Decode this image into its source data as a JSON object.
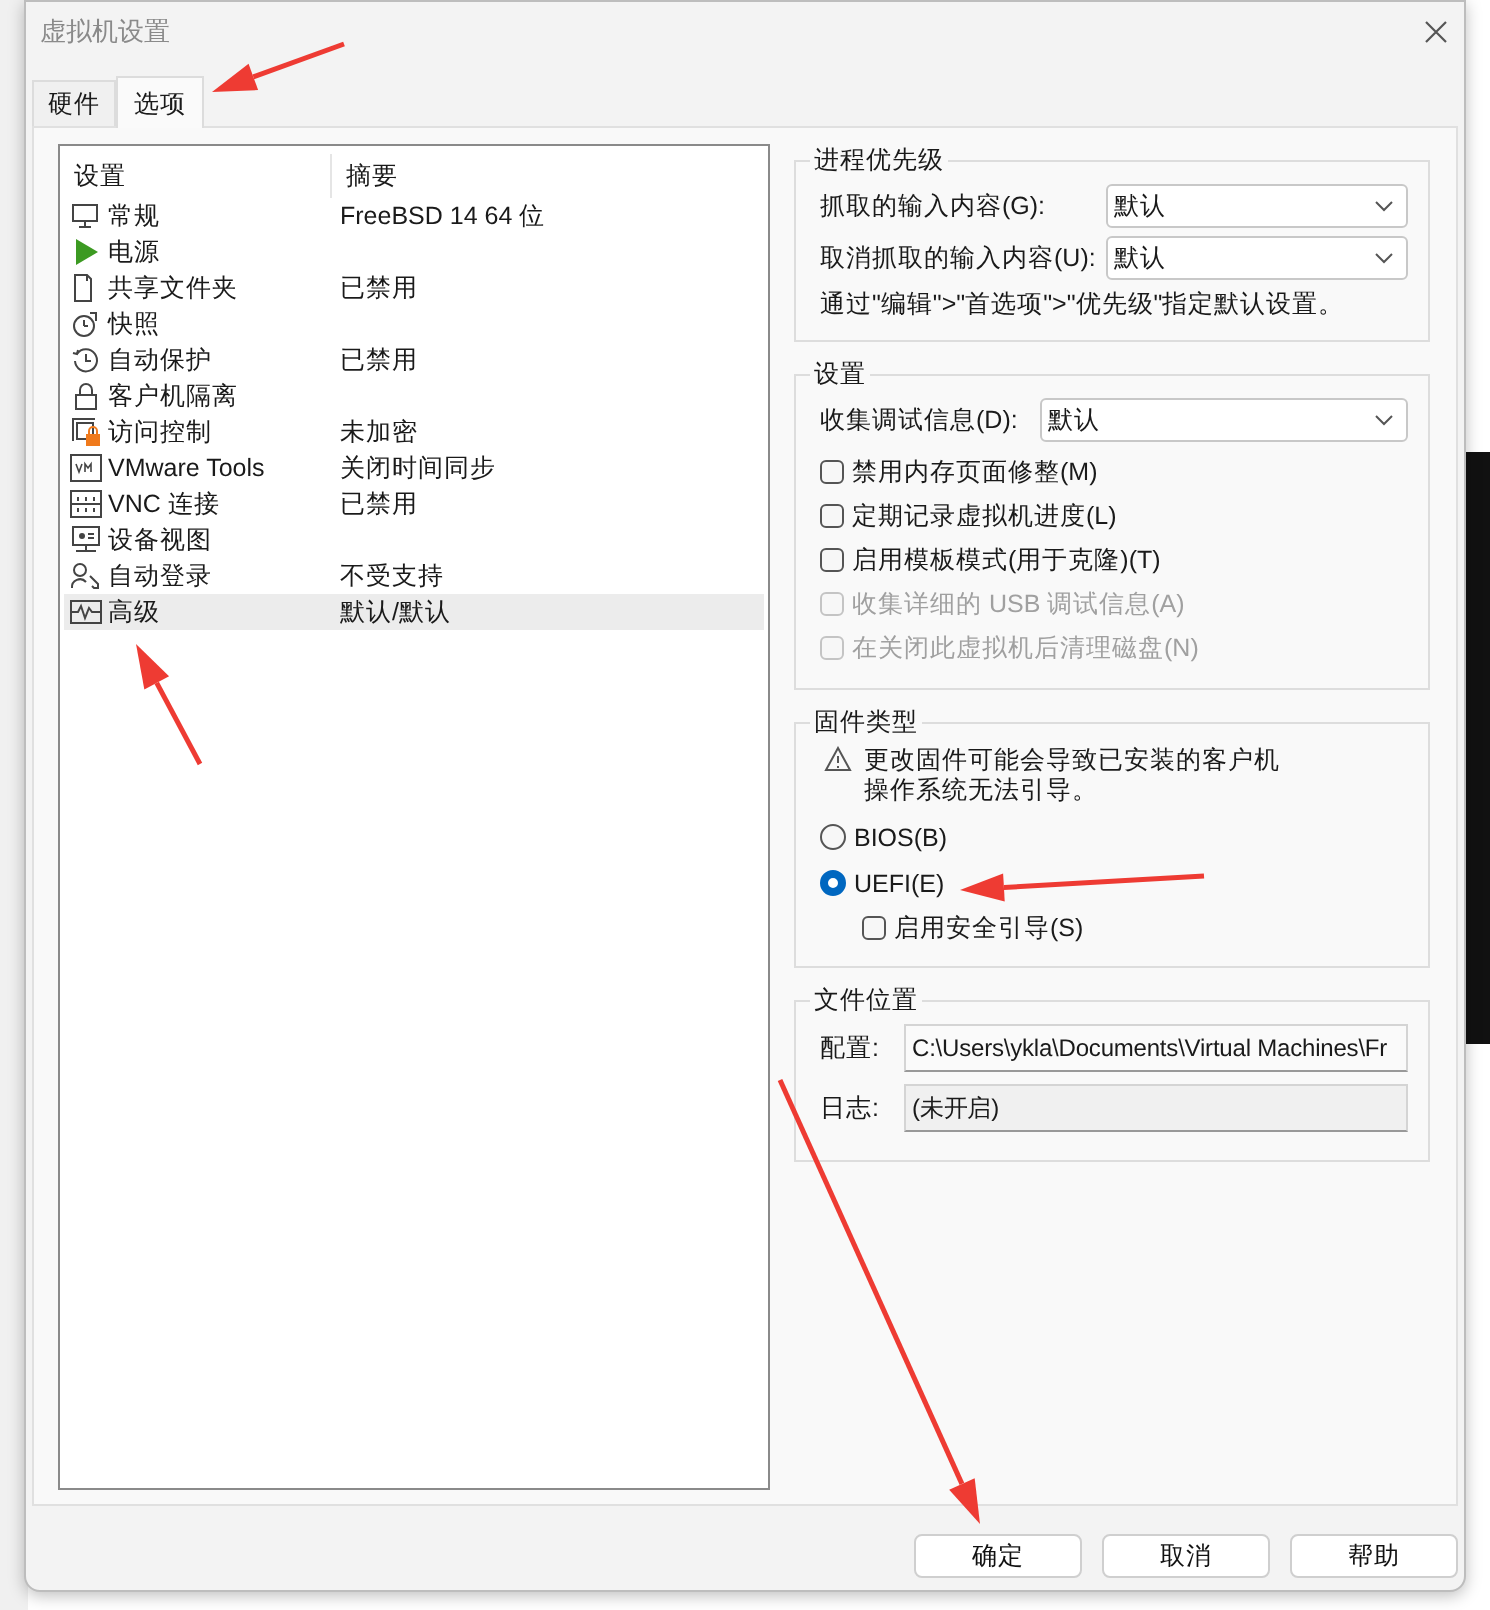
{
  "window": {
    "title": "虚拟机设置"
  },
  "tabs": [
    {
      "label": "硬件",
      "selected": false
    },
    {
      "label": "选项",
      "selected": true
    }
  ],
  "settings_list": {
    "columns": [
      "设置",
      "摘要"
    ],
    "rows": [
      {
        "kind": "monitor",
        "name": "常规",
        "summary": "FreeBSD 14 64 位",
        "selected": false
      },
      {
        "kind": "play",
        "name": "电源",
        "selected": false
      },
      {
        "kind": "folder",
        "name": "共享文件夹",
        "summary": "已禁用",
        "selected": false
      },
      {
        "kind": "stopwatch",
        "name": "快照",
        "selected": false
      },
      {
        "kind": "history",
        "name": "自动保护",
        "summary": "已禁用",
        "selected": false
      },
      {
        "kind": "lock",
        "name": "客户机隔离",
        "selected": false
      },
      {
        "kind": "lockwindow",
        "name": "访问控制",
        "summary": "未加密",
        "selected": false
      },
      {
        "kind": "vm",
        "name": "VMware Tools",
        "summary": "关闭时间同步",
        "selected": false
      },
      {
        "kind": "network",
        "name": "VNC 连接",
        "summary": "已禁用",
        "selected": false
      },
      {
        "kind": "device",
        "name": "设备视图",
        "selected": false
      },
      {
        "kind": "userkey",
        "name": "自动登录",
        "summary": "不受支持",
        "selected": false
      },
      {
        "kind": "wave",
        "name": "高级",
        "summary": "默认/默认",
        "selected": true
      }
    ]
  },
  "process_priority": {
    "title": "进程优先级",
    "fields": [
      {
        "label": "抓取的输入内容(G):",
        "value": "默认"
      },
      {
        "label": "取消抓取的输入内容(U):",
        "value": "默认"
      }
    ],
    "note": "通过\"编辑\">\"首选项\">\"优先级\"指定默认设置。"
  },
  "settings": {
    "title": "设置",
    "field": {
      "label": "收集调试信息(D):",
      "value": "默认"
    },
    "options": [
      {
        "label": "禁用内存页面修整(M)",
        "checked": false,
        "disabled": false
      },
      {
        "label": "定期记录虚拟机进度(L)",
        "checked": false,
        "disabled": false
      },
      {
        "label": "启用模板模式(用于克隆)(T)",
        "checked": false,
        "disabled": false
      },
      {
        "label": "收集详细的 USB 调试信息(A)",
        "checked": false,
        "disabled": true
      },
      {
        "label": "在关闭此虚拟机后清理磁盘(N)",
        "checked": false,
        "disabled": true
      }
    ]
  },
  "firmware": {
    "title": "固件类型",
    "warning": "更改固件可能会导致已安装的客户机操作系统无法引导。",
    "options": [
      {
        "label": "BIOS(B)",
        "selected": false
      },
      {
        "label": "UEFI(E)",
        "selected": true
      }
    ],
    "secure_boot": {
      "label": "启用安全引导(S)",
      "checked": false
    }
  },
  "file_location": {
    "title": "文件位置",
    "fields": [
      {
        "label": "配置:",
        "value": "C:\\Users\\ykla\\Documents\\Virtual Machines\\Fr"
      },
      {
        "label": "日志:",
        "value": "(未开启)"
      }
    ]
  },
  "buttons": [
    {
      "label": "确定"
    },
    {
      "label": "取消"
    },
    {
      "label": "帮助"
    }
  ]
}
